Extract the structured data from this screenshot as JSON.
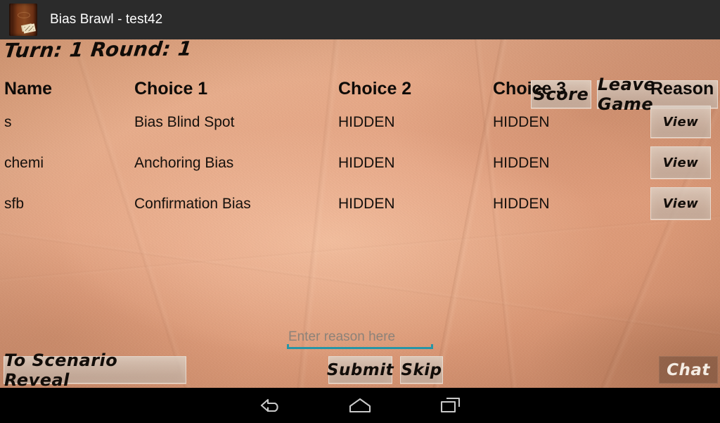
{
  "titlebar": {
    "app_icon": "book-icon",
    "title": "Bias Brawl - test42"
  },
  "header": {
    "turn_round": "Turn: 1 Round: 1",
    "score_label": "Score",
    "leave_game_label": "Leave Game"
  },
  "table": {
    "columns": [
      "Name",
      "Choice 1",
      "Choice 2",
      "Choice 3",
      "Reason"
    ],
    "rows": [
      {
        "name": "s",
        "choice1": "Bias Blind Spot",
        "choice2": "HIDDEN",
        "choice3": "HIDDEN",
        "reason_label": "View"
      },
      {
        "name": "chemi",
        "choice1": "Anchoring Bias",
        "choice2": "HIDDEN",
        "choice3": "HIDDEN",
        "reason_label": "View"
      },
      {
        "name": "sfb",
        "choice1": "Confirmation Bias",
        "choice2": "HIDDEN",
        "choice3": "HIDDEN",
        "reason_label": "View"
      }
    ]
  },
  "reason_input": {
    "placeholder": "Enter reason here",
    "value": ""
  },
  "footer": {
    "scenario_reveal_label": "To Scenario Reveal",
    "submit_label": "Submit",
    "skip_label": "Skip",
    "chat_label": "Chat"
  },
  "navbar": {
    "back": "back-icon",
    "home": "home-icon",
    "recent": "recent-apps-icon"
  },
  "colors": {
    "titlebar_bg": "#2b2b2b",
    "paper_light": "#e7ad8c",
    "paper_dark": "#cf8c6c",
    "input_accent": "#2795a6",
    "navbar_bg": "#000000",
    "text_dark": "#15100c"
  }
}
